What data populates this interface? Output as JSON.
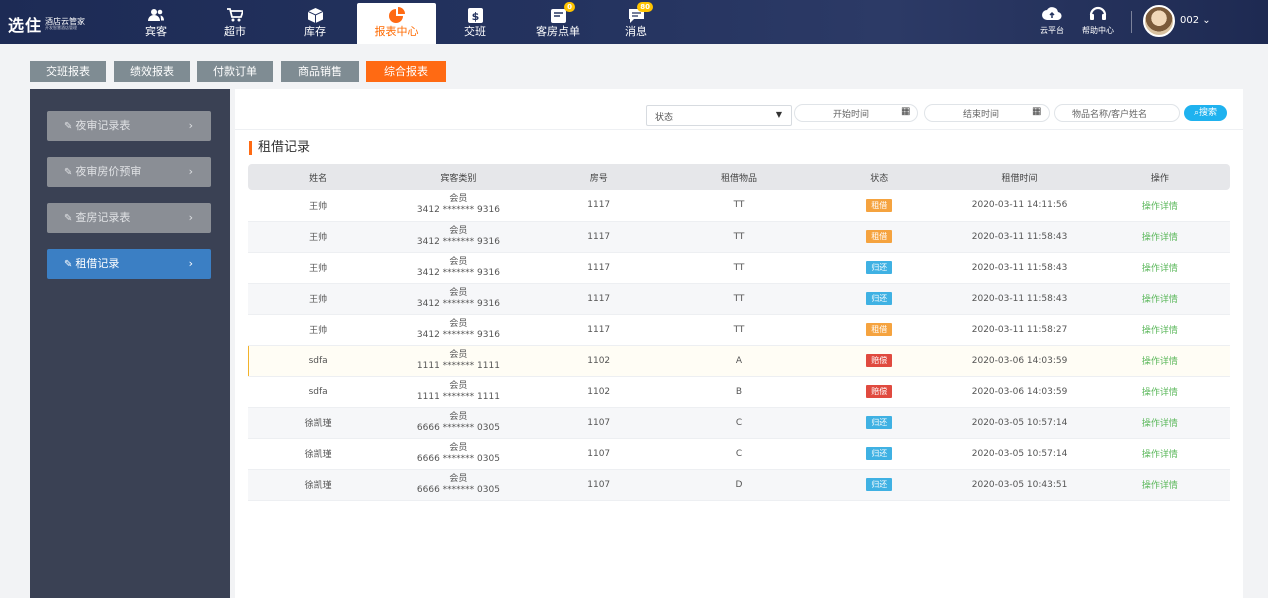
{
  "app": {
    "logo_big": "选住",
    "logo_line1": "酒店云管家",
    "logo_line2": "开发智慧酒店管理"
  },
  "nav": [
    {
      "label": "宾客",
      "icon": "users-icon"
    },
    {
      "label": "超市",
      "icon": "cart-icon"
    },
    {
      "label": "库存",
      "icon": "box-icon"
    },
    {
      "label": "报表中心",
      "icon": "pie-chart-icon",
      "active": true
    },
    {
      "label": "交班",
      "icon": "dollar-icon"
    },
    {
      "label": "客房点单",
      "icon": "room-order-icon",
      "badge": "0"
    },
    {
      "label": "消息",
      "icon": "message-icon",
      "badge": "80"
    }
  ],
  "top_right": {
    "cloud": "云平台",
    "help": "帮助中心",
    "user": "002"
  },
  "tabs": [
    "交班报表",
    "绩效报表",
    "付款订单",
    "商品销售",
    "综合报表"
  ],
  "sidebar": [
    {
      "label": "夜审记录表"
    },
    {
      "label": "夜审房价预审"
    },
    {
      "label": "查房记录表"
    },
    {
      "label": "租借记录",
      "active": true
    }
  ],
  "filters": {
    "status_value": "状态",
    "start_placeholder": "开始时间",
    "end_placeholder": "结束时间",
    "keyword_placeholder": "物品名称/客户姓名",
    "search_label": "搜索"
  },
  "section_title": "租借记录",
  "table": {
    "columns": [
      "姓名",
      "宾客类别",
      "房号",
      "租借物品",
      "状态",
      "租借时间",
      "操作"
    ],
    "rows": [
      {
        "name": "王帅",
        "type": "会员",
        "card": "3412 ******* 9316",
        "room": "1117",
        "item": "TT",
        "status": "租借",
        "time": "2020-03-11 14:11:56",
        "op": "操作详情"
      },
      {
        "name": "王帅",
        "type": "会员",
        "card": "3412 ******* 9316",
        "room": "1117",
        "item": "TT",
        "status": "租借",
        "time": "2020-03-11 11:58:43",
        "op": "操作详情"
      },
      {
        "name": "王帅",
        "type": "会员",
        "card": "3412 ******* 9316",
        "room": "1117",
        "item": "TT",
        "status": "归还",
        "time": "2020-03-11 11:58:43",
        "op": "操作详情"
      },
      {
        "name": "王帅",
        "type": "会员",
        "card": "3412 ******* 9316",
        "room": "1117",
        "item": "TT",
        "status": "归还",
        "time": "2020-03-11 11:58:43",
        "op": "操作详情"
      },
      {
        "name": "王帅",
        "type": "会员",
        "card": "3412 ******* 9316",
        "room": "1117",
        "item": "TT",
        "status": "租借",
        "time": "2020-03-11 11:58:27",
        "op": "操作详情"
      },
      {
        "name": "sdfa",
        "type": "会员",
        "card": "1111 ******* 1111",
        "room": "1102",
        "item": "A",
        "status": "赔偿",
        "time": "2020-03-06 14:03:59",
        "op": "操作详情"
      },
      {
        "name": "sdfa",
        "type": "会员",
        "card": "1111 ******* 1111",
        "room": "1102",
        "item": "B",
        "status": "赔偿",
        "time": "2020-03-06 14:03:59",
        "op": "操作详情"
      },
      {
        "name": "徐凯瑾",
        "type": "会员",
        "card": "6666 ******* 0305",
        "room": "1107",
        "item": "C",
        "status": "归还",
        "time": "2020-03-05 10:57:14",
        "op": "操作详情"
      },
      {
        "name": "徐凯瑾",
        "type": "会员",
        "card": "6666 ******* 0305",
        "room": "1107",
        "item": "C",
        "status": "归还",
        "time": "2020-03-05 10:57:14",
        "op": "操作详情"
      },
      {
        "name": "徐凯瑾",
        "type": "会员",
        "card": "6666 ******* 0305",
        "room": "1107",
        "item": "D",
        "status": "归还",
        "time": "2020-03-05 10:43:51",
        "op": "操作详情"
      }
    ]
  },
  "status_colors": {
    "租借": "#f5a33f",
    "归还": "#3fb1e3",
    "赔偿": "#e04a3f"
  },
  "colors": {
    "accent": "#ff6a13",
    "topbar": "#24335f",
    "sidebar": "#3a4154",
    "side_active": "#3b7fc4",
    "search": "#1fb2ef",
    "op_link": "#5cb85c"
  }
}
